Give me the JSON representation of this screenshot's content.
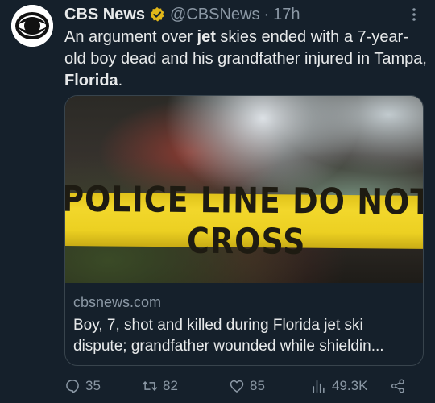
{
  "post": {
    "author_name": "CBS News",
    "handle": "@CBSNews",
    "separator": "·",
    "time": "17h",
    "text": {
      "part1": "An argument over ",
      "bold1": "jet",
      "part2": " skies ended with a 7-year-old boy dead and his grandfather injured in Tampa, ",
      "bold2": "Florida",
      "part3": "."
    }
  },
  "card": {
    "image_text": "POLICE LINE DO NOT CROSS",
    "domain": "cbsnews.com",
    "title": "Boy, 7, shot and killed during Florida jet ski dispute; grandfather wounded while shieldin..."
  },
  "actions": {
    "replies": "35",
    "reposts": "82",
    "likes": "85",
    "views": "49.3K"
  },
  "icons": {
    "avatar": "cbs-eye-logo",
    "verified": "verified-badge-icon",
    "more": "more-options-icon",
    "reply": "reply-icon",
    "repost": "repost-icon",
    "like": "heart-icon",
    "views": "views-icon",
    "share": "share-icon"
  },
  "colors": {
    "background": "#15202b",
    "text": "#e7e9ea",
    "muted": "#8b98a5",
    "border": "#38444d",
    "verified_gold": "#e2b719",
    "tape_yellow": "#f2d72b"
  }
}
